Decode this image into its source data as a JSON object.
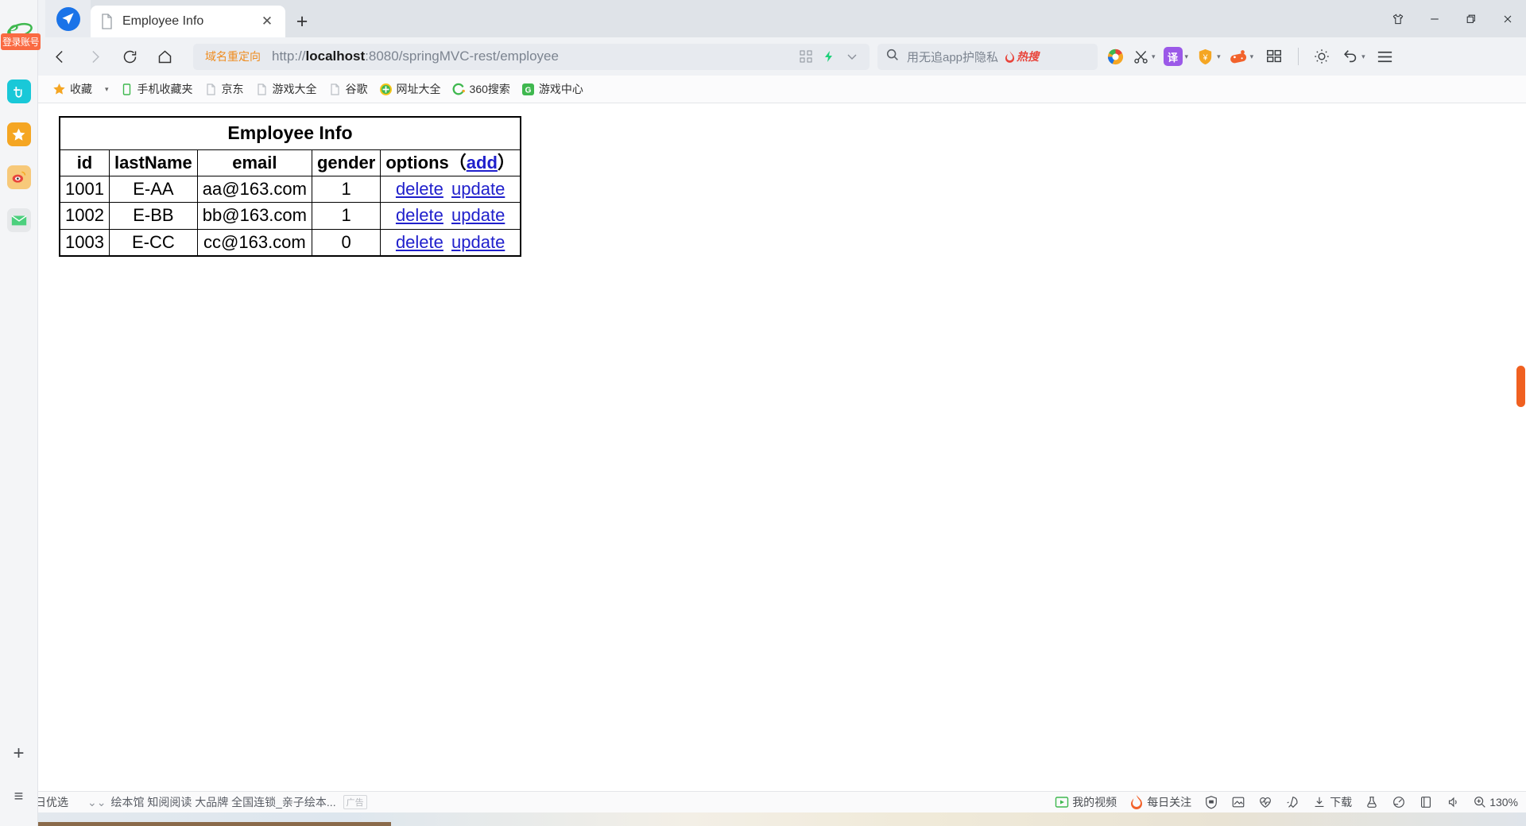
{
  "window": {
    "controls": {
      "skin": "tshirt-icon",
      "minimize": "minimize-icon",
      "restore": "restore-icon",
      "close": "close-icon"
    }
  },
  "tabs": [
    {
      "title": "Employee Info",
      "favicon": "document-icon",
      "active": true
    }
  ],
  "newtab_label": "+",
  "toolbar": {
    "back": "‹",
    "forward": "›",
    "reload": "reload-icon",
    "home": "home-icon",
    "url_badge": "域名重定向",
    "url_prefix": "http://",
    "url_host": "localhost",
    "url_rest": ":8080/springMVC-rest/employee",
    "url_full": "http://localhost:8080/springMVC-rest/employee",
    "qr_icon": "qrcode-icon",
    "lightning_icon": "lightning-icon",
    "dropdown_icon": "chevron-down-icon",
    "search_placeholder": "用无追app护隐私",
    "hot_badge": "热搜",
    "icons": [
      {
        "name": "app-circle-icon",
        "label": ""
      },
      {
        "name": "scissors-icon",
        "label": ""
      },
      {
        "name": "translate-icon",
        "label": "译"
      },
      {
        "name": "coupon-shield-icon",
        "label": "¥"
      },
      {
        "name": "game-controller-icon",
        "label": ""
      },
      {
        "name": "apps-grid-icon",
        "label": ""
      },
      {
        "name": "brightness-icon",
        "label": ""
      },
      {
        "name": "undo-icon",
        "label": ""
      },
      {
        "name": "menu-icon",
        "label": ""
      }
    ]
  },
  "bookmarks": [
    {
      "label": "收藏",
      "icon": "star-icon",
      "has_caret": true
    },
    {
      "label": "手机收藏夹",
      "icon": "phone-icon",
      "has_caret": false
    },
    {
      "label": "京东",
      "icon": "page-icon",
      "has_caret": false
    },
    {
      "label": "游戏大全",
      "icon": "page-icon",
      "has_caret": false
    },
    {
      "label": "谷歌",
      "icon": "page-icon",
      "has_caret": false
    },
    {
      "label": "网址大全",
      "icon": "plus-circle-icon",
      "has_caret": false
    },
    {
      "label": "360搜索",
      "icon": "360-icon",
      "has_caret": false
    },
    {
      "label": "游戏中心",
      "icon": "g-icon",
      "has_caret": false
    }
  ],
  "sidebar": {
    "logo": "ie-logo-icon",
    "login_badge": "登录账号",
    "items": [
      {
        "name": "sidebar-item-app",
        "icon": "cross-app-icon",
        "color": "#19c8d8"
      },
      {
        "name": "sidebar-item-favorites",
        "icon": "star-icon",
        "color": "#f5a623"
      },
      {
        "name": "sidebar-item-weibo",
        "icon": "weibo-icon",
        "color": "#f7c97a"
      },
      {
        "name": "sidebar-item-mail",
        "icon": "mail-icon",
        "color": "#4cd07d"
      }
    ],
    "add_label": "+",
    "list_label": "≡"
  },
  "content": {
    "table": {
      "caption": "Employee Info",
      "headers": [
        "id",
        "lastName",
        "email",
        "gender",
        "options"
      ],
      "options_header_prefix": "options（",
      "options_header_link": "add",
      "options_header_suffix": "）",
      "rows": [
        {
          "id": "1001",
          "lastName": "E-AA",
          "email": "aa@163.com",
          "gender": "1",
          "actions": [
            "delete",
            "update"
          ]
        },
        {
          "id": "1002",
          "lastName": "E-BB",
          "email": "bb@163.com",
          "gender": "1",
          "actions": [
            "delete",
            "update"
          ]
        },
        {
          "id": "1003",
          "lastName": "E-CC",
          "email": "cc@163.com",
          "gender": "0",
          "actions": [
            "delete",
            "update"
          ]
        }
      ]
    }
  },
  "statusbar": {
    "today_label": "今日优选",
    "ad_text": "绘本馆 知阅阅读 大品牌 全国连锁_亲子绘本...",
    "ad_tag": "广告",
    "right_items": [
      {
        "name": "my-video",
        "label": "我的视频",
        "icon": "play-icon"
      },
      {
        "name": "daily-focus",
        "label": "每日关注",
        "icon": "flame-icon"
      },
      {
        "name": "security",
        "label": "",
        "icon": "shield-icon"
      },
      {
        "name": "screenshot",
        "label": "",
        "icon": "image-icon"
      },
      {
        "name": "health",
        "label": "",
        "icon": "heartbeat-icon"
      },
      {
        "name": "accelerate",
        "label": "",
        "icon": "rocket-icon"
      },
      {
        "name": "downloads",
        "label": "下载",
        "icon": "download-icon"
      },
      {
        "name": "lab",
        "label": "",
        "icon": "flask-icon"
      },
      {
        "name": "speed",
        "label": "",
        "icon": "speedometer-icon"
      },
      {
        "name": "reading-mode",
        "label": "",
        "icon": "book-icon"
      },
      {
        "name": "sound",
        "label": "",
        "icon": "volume-icon"
      }
    ],
    "zoom_level": "130%",
    "zoom_icon": "zoom-in-icon"
  },
  "colors": {
    "accent_blue": "#1a73e8",
    "link_blue": "#2020cc",
    "orange": "#ef8c1f",
    "red_badge": "#fa6a42",
    "scroll_thumb": "#f06020"
  }
}
